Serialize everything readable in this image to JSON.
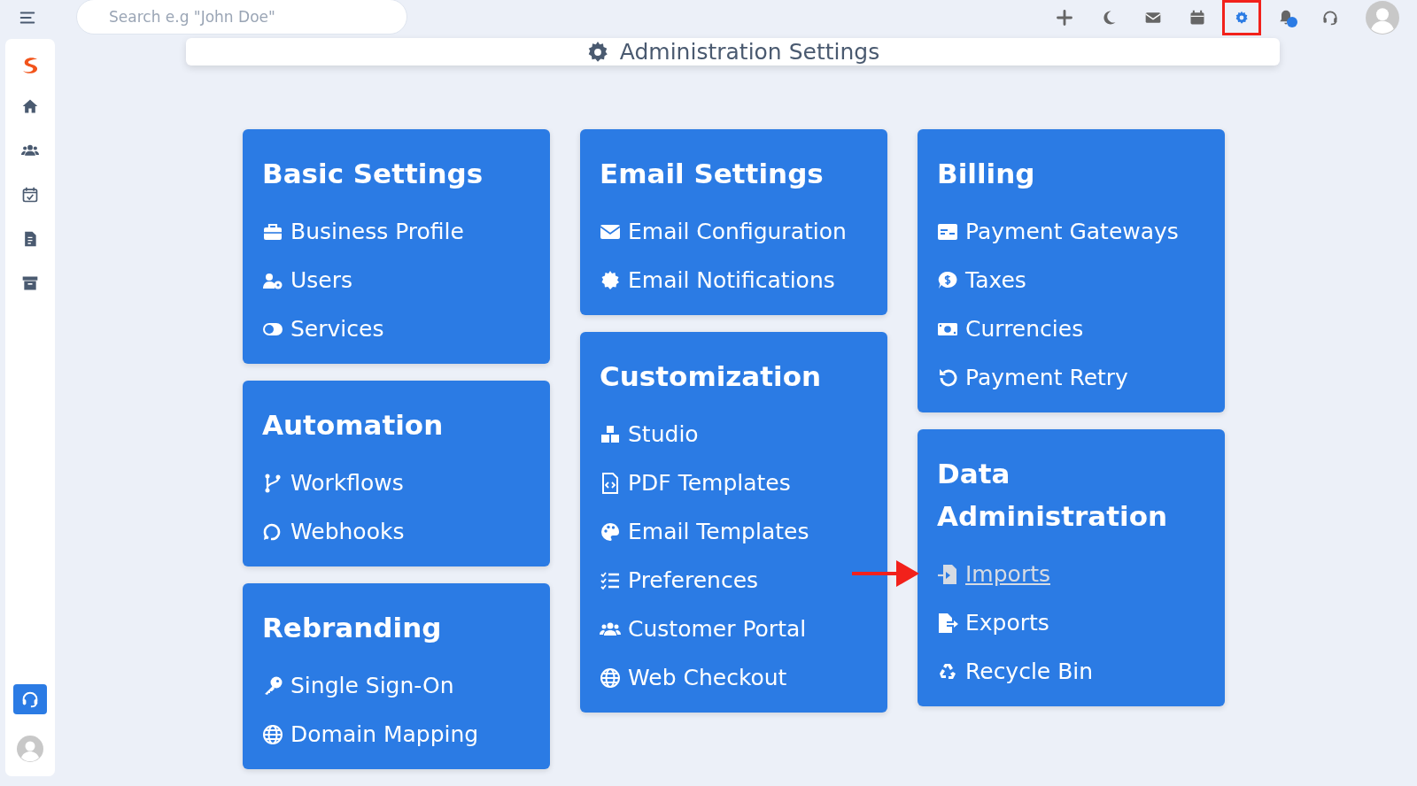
{
  "search": {
    "placeholder": "Search e.g \"John Doe\""
  },
  "toolbar": [
    {
      "highlighted": false
    },
    {
      "highlighted": false
    },
    {
      "highlighted": false
    },
    {
      "highlighted": false
    },
    {
      "highlighted": true
    },
    {
      "highlighted": false
    },
    {
      "highlighted": false
    }
  ],
  "notifications": {
    "unread": true
  },
  "sidebar": {
    "items": [
      {
        "selected": false
      },
      {
        "selected": false
      },
      {
        "selected": false
      },
      {
        "selected": false
      },
      {
        "selected": false
      }
    ]
  },
  "header": {
    "title": "Administration Settings"
  },
  "columns": [
    [
      {
        "title": "Basic Settings",
        "items": [
          {
            "label": "Business Profile",
            "highlighted": false
          },
          {
            "label": "Users",
            "highlighted": false
          },
          {
            "label": "Services",
            "highlighted": false
          }
        ]
      },
      {
        "title": "Automation",
        "items": [
          {
            "label": "Workflows",
            "highlighted": false
          },
          {
            "label": "Webhooks",
            "highlighted": false
          }
        ]
      },
      {
        "title": "Rebranding",
        "items": [
          {
            "label": "Single Sign-On",
            "highlighted": false
          },
          {
            "label": "Domain Mapping",
            "highlighted": false
          }
        ]
      }
    ],
    [
      {
        "title": "Email Settings",
        "items": [
          {
            "label": "Email Configuration",
            "highlighted": false
          },
          {
            "label": "Email Notifications",
            "highlighted": false
          }
        ]
      },
      {
        "title": "Customization",
        "items": [
          {
            "label": "Studio",
            "highlighted": false
          },
          {
            "label": "PDF Templates",
            "highlighted": false
          },
          {
            "label": "Email Templates",
            "highlighted": false
          },
          {
            "label": "Preferences",
            "highlighted": false
          },
          {
            "label": "Customer Portal",
            "highlighted": false
          },
          {
            "label": "Web Checkout",
            "highlighted": false
          }
        ]
      }
    ],
    [
      {
        "title": "Billing",
        "items": [
          {
            "label": "Payment Gateways",
            "highlighted": false
          },
          {
            "label": "Taxes",
            "highlighted": false
          },
          {
            "label": "Currencies",
            "highlighted": false
          },
          {
            "label": "Payment Retry",
            "highlighted": false
          }
        ]
      },
      {
        "title": "Data Administration",
        "items": [
          {
            "label": "Imports",
            "highlighted": true
          },
          {
            "label": "Exports",
            "highlighted": false
          },
          {
            "label": "Recycle Bin",
            "highlighted": false
          }
        ]
      }
    ]
  ]
}
